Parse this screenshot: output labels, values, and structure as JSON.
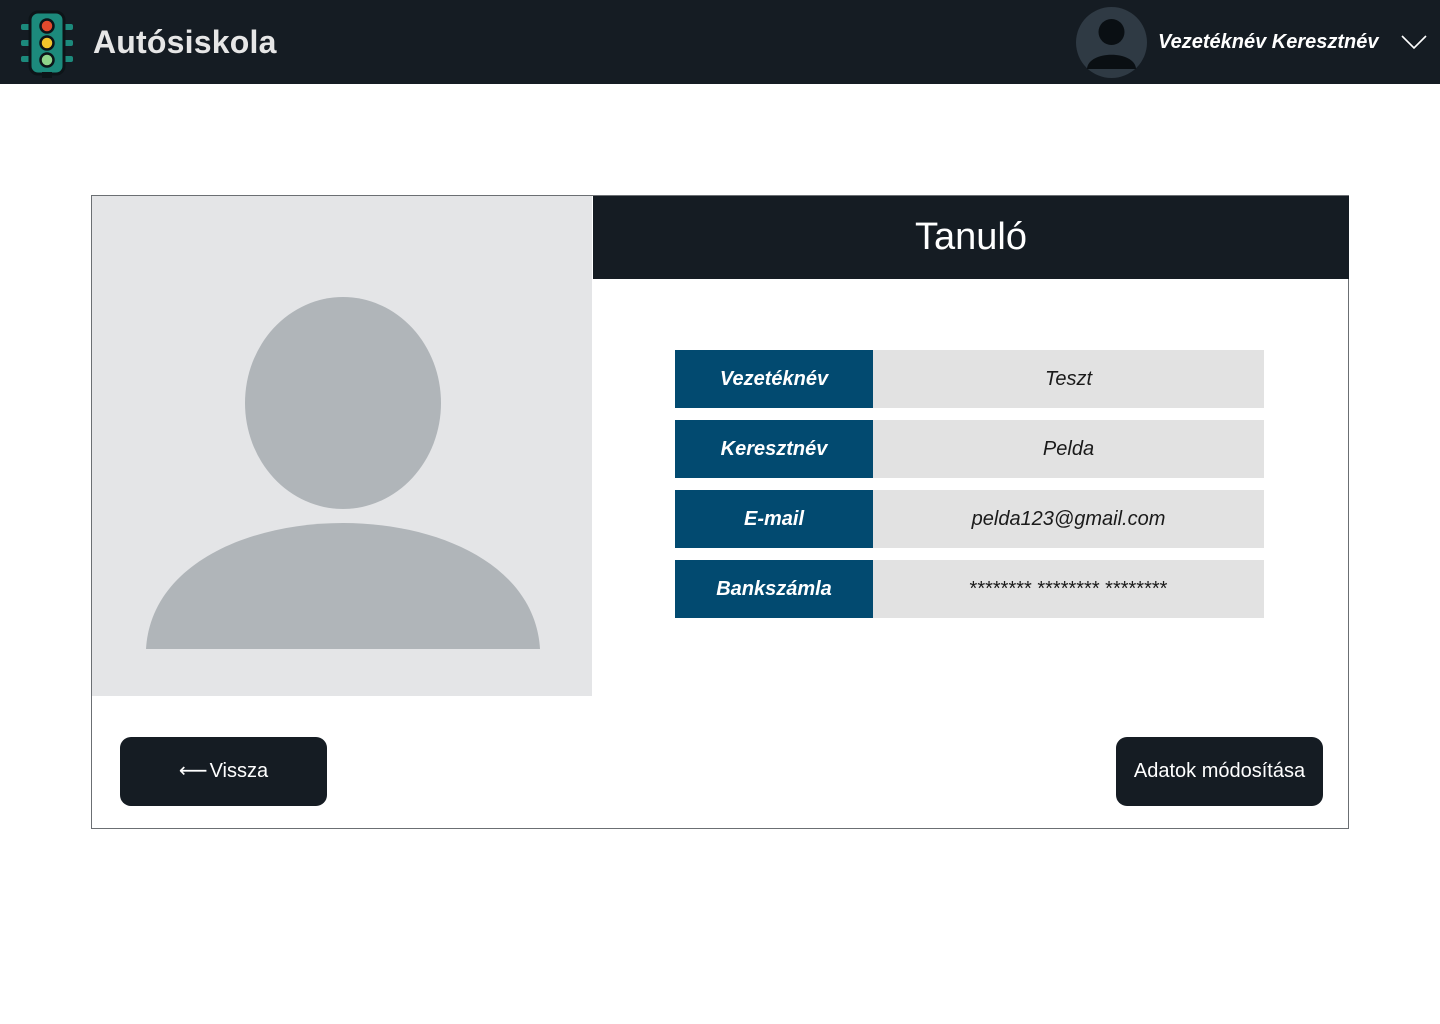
{
  "header": {
    "app_title": "Autósiskola",
    "logo_icon": "traffic-light-icon",
    "user": {
      "name": "Vezetéknév Keresztnév",
      "avatar_icon": "user-avatar-icon",
      "menu_icon": "chevron-down-icon"
    }
  },
  "profile": {
    "title": "Tanuló",
    "photo_icon": "user-placeholder-icon",
    "fields": [
      {
        "label": "Vezetéknév",
        "value": "Teszt"
      },
      {
        "label": "Keresztnév",
        "value": "Pelda"
      },
      {
        "label": "E-mail",
        "value": "pelda123@gmail.com"
      },
      {
        "label": "Bankszámla",
        "value": "******** ******** ********"
      }
    ]
  },
  "actions": {
    "back_arrow": "⟵",
    "back_label": "Vissza",
    "edit_label": "Adatok módosítása"
  },
  "colors": {
    "dark": "#151c23",
    "label_bg": "#024a70",
    "value_bg": "#e2e2e2",
    "photo_bg": "#e4e5e7",
    "silhouette": "#b0b5b9"
  }
}
